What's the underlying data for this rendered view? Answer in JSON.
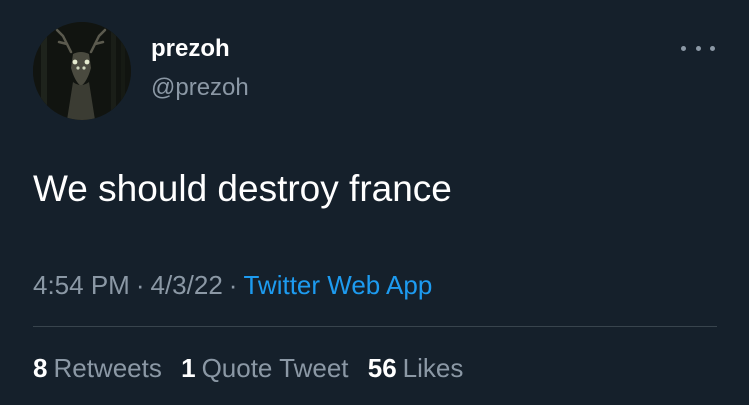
{
  "user": {
    "display_name": "prezoh",
    "handle": "@prezoh",
    "avatar_icon": "deer-avatar"
  },
  "more_icon": "more-horizontal-icon",
  "tweet": {
    "text": "We should destroy france"
  },
  "meta": {
    "time": "4:54 PM",
    "date": "4/3/22",
    "separator": "·",
    "source": "Twitter Web App"
  },
  "stats": {
    "retweets": {
      "count": "8",
      "label": "Retweets"
    },
    "quotes": {
      "count": "1",
      "label": "Quote Tweet"
    },
    "likes": {
      "count": "56",
      "label": "Likes"
    }
  },
  "colors": {
    "background": "#15202b",
    "primary_text": "#ffffff",
    "secondary_text": "#8b98a5",
    "link": "#1d9bf0",
    "divider": "#38444d"
  }
}
